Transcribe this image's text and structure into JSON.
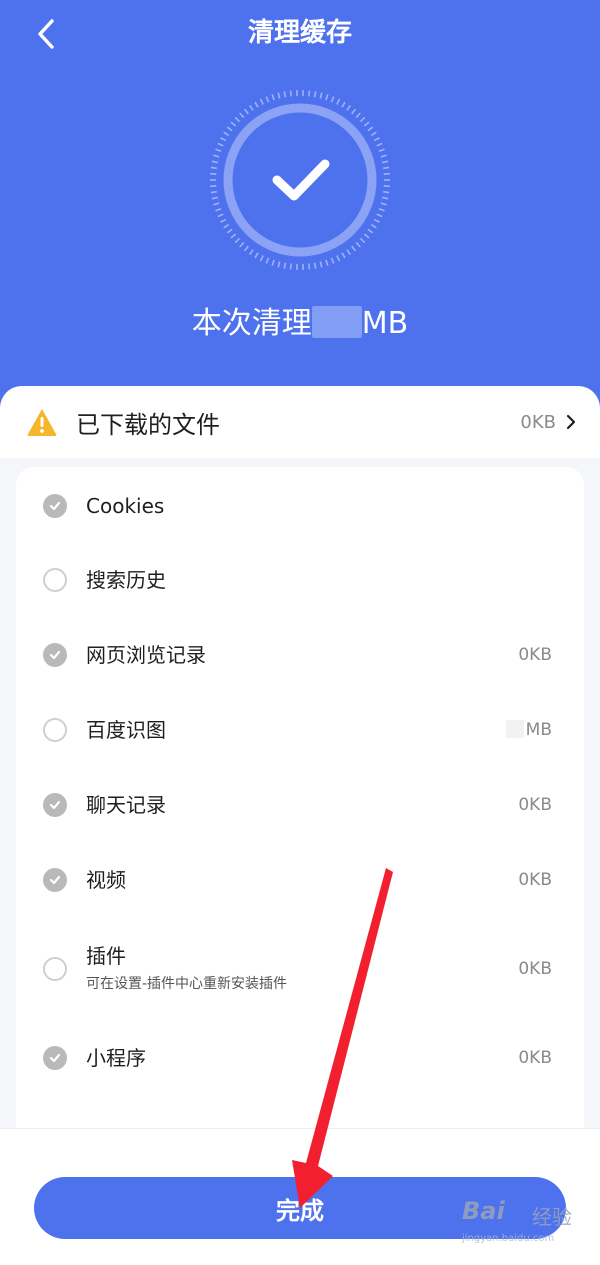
{
  "header": {
    "title": "清理缓存",
    "back_icon": "chevron-left-icon"
  },
  "hero": {
    "cleaned_prefix": "本次清理",
    "cleaned_suffix": "MB",
    "status_icon": "checkmark-icon"
  },
  "downloads": {
    "label": "已下载的文件",
    "size": "0KB",
    "warning_icon": "warning-icon",
    "chevron_icon": "chevron-right-icon"
  },
  "items": [
    {
      "name": "Cookies",
      "checked": true,
      "size": "",
      "subtitle": ""
    },
    {
      "name": "搜索历史",
      "checked": false,
      "size": "",
      "subtitle": ""
    },
    {
      "name": "网页浏览记录",
      "checked": true,
      "size": "0KB",
      "subtitle": ""
    },
    {
      "name": "百度识图",
      "checked": false,
      "size": "MB",
      "subtitle": ""
    },
    {
      "name": "聊天记录",
      "checked": true,
      "size": "0KB",
      "subtitle": ""
    },
    {
      "name": "视频",
      "checked": true,
      "size": "0KB",
      "subtitle": ""
    },
    {
      "name": "插件",
      "checked": false,
      "size": "0KB",
      "subtitle": "可在设置-插件中心重新安装插件"
    },
    {
      "name": "小程序",
      "checked": true,
      "size": "0KB",
      "subtitle": ""
    }
  ],
  "footer": {
    "done_label": "完成"
  },
  "watermark": {
    "brand": "Bai",
    "brand_cn": "经验",
    "url": "jingyan.baidu.com"
  },
  "colors": {
    "primary": "#4e71ee",
    "check_on": "#b9b9b9",
    "annotation_arrow": "#f2202e",
    "warning": "#f7b52c"
  }
}
